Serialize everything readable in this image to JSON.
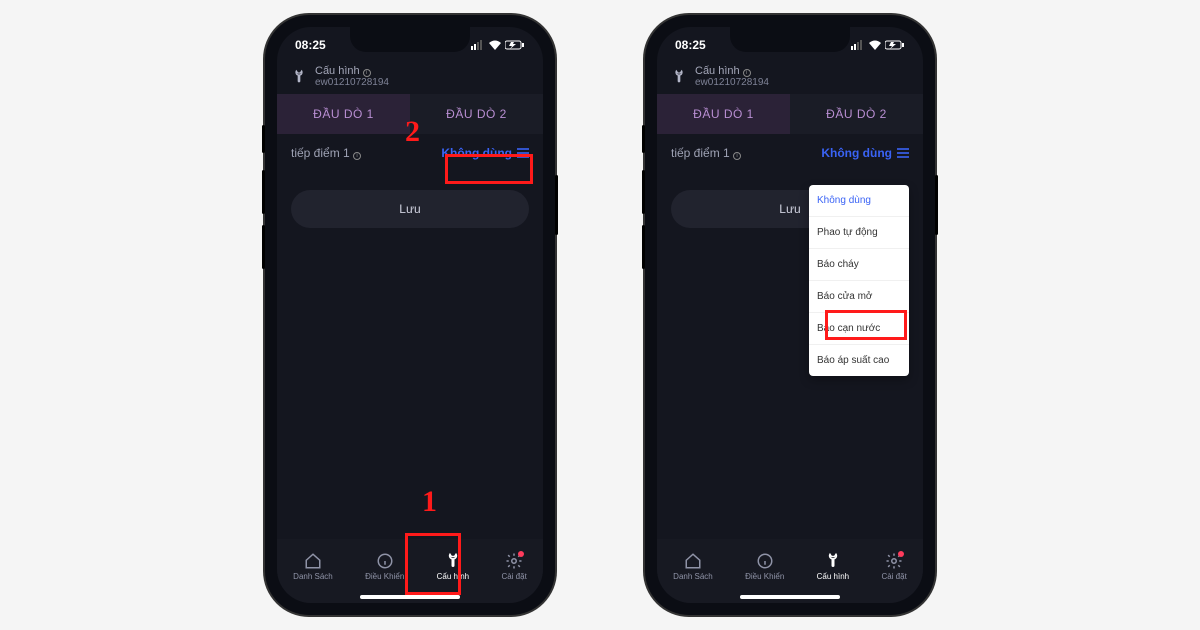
{
  "status": {
    "time": "08:25",
    "signal": "▮▯",
    "wifi": "✦",
    "battery": "⚡"
  },
  "header": {
    "title": "Cấu hình",
    "device_id": "ew01210728194"
  },
  "tabs": {
    "t1": "ĐẦU DÒ 1",
    "t2": "ĐẦU DÒ 2"
  },
  "row1": {
    "label": "tiếp điểm 1",
    "value": "Không dùng"
  },
  "save": "Lưu",
  "nav": {
    "list": {
      "label": "Danh Sách"
    },
    "ctrl": {
      "label": "Điều Khiển"
    },
    "config": {
      "label": "Cấu hình"
    },
    "setup": {
      "label": "Cài đặt"
    }
  },
  "dropdown": {
    "o0": "Không dùng",
    "o1": "Phao tự động",
    "o2": "Báo cháy",
    "o3": "Báo cửa mở",
    "o4": "Báo cạn nước",
    "o5": "Báo áp suất cao"
  },
  "callouts": {
    "c1": "1",
    "c2": "2"
  }
}
